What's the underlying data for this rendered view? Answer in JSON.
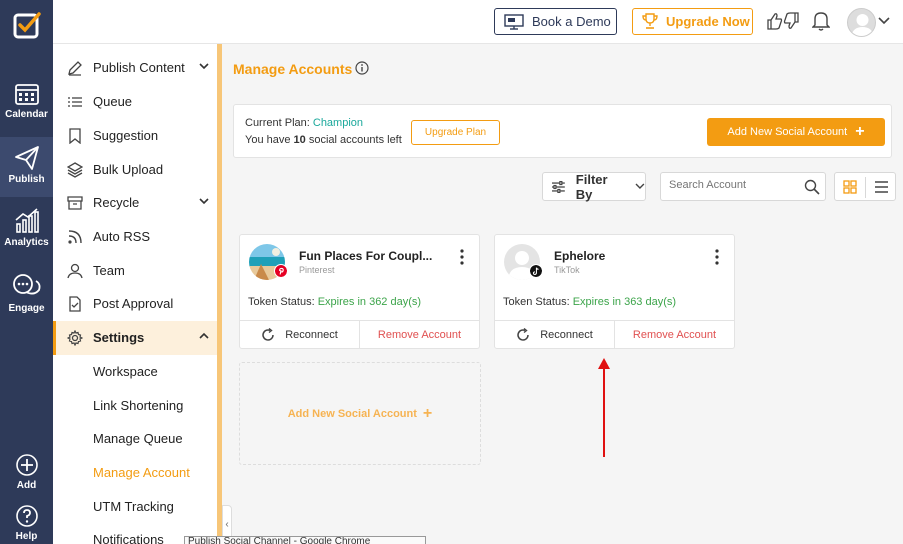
{
  "rail": {
    "items": [
      {
        "label": "Calendar",
        "icon": "calendar-icon"
      },
      {
        "label": "Publish",
        "icon": "paper-plane-icon"
      },
      {
        "label": "Analytics",
        "icon": "bar-chart-icon"
      },
      {
        "label": "Engage",
        "icon": "chat-bubbles-icon"
      },
      {
        "label": "Add",
        "icon": "plus-circle-icon"
      },
      {
        "label": "Help",
        "icon": "question-circle-icon"
      }
    ]
  },
  "topbar": {
    "book_demo": "Book a Demo",
    "upgrade_now": "Upgrade Now"
  },
  "nav": {
    "items": [
      {
        "label": "Publish Content",
        "icon": "pencil-icon"
      },
      {
        "label": "Queue",
        "icon": "list-icon"
      },
      {
        "label": "Suggestion",
        "icon": "bookmark-icon"
      },
      {
        "label": "Bulk Upload",
        "icon": "layers-icon"
      },
      {
        "label": "Recycle",
        "icon": "archive-icon"
      },
      {
        "label": "Auto RSS",
        "icon": "rss-icon"
      },
      {
        "label": "Team",
        "icon": "user-icon"
      },
      {
        "label": "Post Approval",
        "icon": "document-check-icon"
      },
      {
        "label": "Settings",
        "icon": "gear-icon"
      }
    ],
    "settings_sub": [
      {
        "label": "Workspace"
      },
      {
        "label": "Link Shortening"
      },
      {
        "label": "Manage Queue"
      },
      {
        "label": "Manage Account"
      },
      {
        "label": "UTM Tracking"
      },
      {
        "label": "Notifications"
      }
    ]
  },
  "main": {
    "title": "Manage Accounts",
    "plan": {
      "current_plan_prefix": "Current Plan:",
      "plan_name": "Champion",
      "you_have": "You have",
      "count": "10",
      "accounts_left": "social accounts left",
      "upgrade_plan": "Upgrade Plan",
      "add_new": "Add New Social Account"
    },
    "filter_by": "Filter By",
    "search_placeholder": "Search Account",
    "accounts": [
      {
        "name": "Fun Places For Coupl...",
        "platform": "Pinterest",
        "token_label": "Token Status:",
        "token_value": "Expires in 362 day(s)",
        "reconnect": "Reconnect",
        "remove": "Remove Account"
      },
      {
        "name": "Ephelore",
        "platform": "TikTok",
        "token_label": "Token Status:",
        "token_value": "Expires in 363 day(s)",
        "reconnect": "Reconnect",
        "remove": "Remove Account"
      }
    ],
    "add_card_label": "Add New Social Account"
  },
  "tooltip": "Publish Social Channel - Google Chrome",
  "colors": {
    "accent": "#f39c12",
    "rail": "#2e3a59",
    "plan_name": "#1aa89b",
    "token_ok": "#3ca44a",
    "remove": "#e05050",
    "annotation_arrow": "#e01010"
  }
}
